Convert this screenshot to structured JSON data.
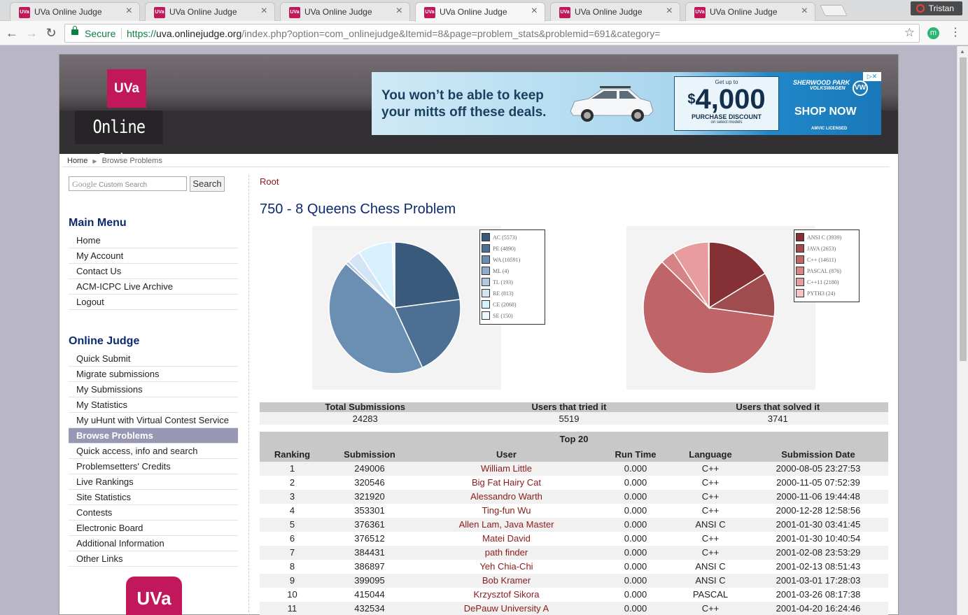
{
  "browser": {
    "tabs": [
      {
        "title": "UVa Online Judge",
        "active": false
      },
      {
        "title": "UVa Online Judge",
        "active": false
      },
      {
        "title": "UVa Online Judge",
        "active": false
      },
      {
        "title": "UVa Online Judge",
        "active": true
      },
      {
        "title": "UVa Online Judge",
        "active": false
      },
      {
        "title": "UVa Online Judge",
        "active": false
      }
    ],
    "favicon_text": "UVa",
    "profile_name": "Tristan",
    "secure_label": "Secure",
    "url_scheme": "https://",
    "url_host": "uva.onlinejudge.org",
    "url_path": "/index.php?option=com_onlinejudge&Itemid=8&page=problem_stats&problemid=691&category=",
    "extension_letter": "m"
  },
  "header": {
    "logo_short": "UVa",
    "logo_text": "Online Judge"
  },
  "ad": {
    "headline_1": "You won’t be able to keep",
    "headline_2": "your mitts off these deals.",
    "get_up_to": "Get up to",
    "currency": "$",
    "amount": "4,000",
    "discount_label": "PURCHASE DISCOUNT",
    "discount_note": "on select models",
    "dealer": "SHERWOOD PARK",
    "dealer_sub": "VOLKSWAGEN",
    "logo_letters": "VW",
    "cta": "SHOP NOW",
    "license": "AMVIC LICENSED"
  },
  "breadcrumb": {
    "home": "Home",
    "current": "Browse Problems"
  },
  "search": {
    "google_label": "Google",
    "placeholder": "Custom Search",
    "button": "Search"
  },
  "main_menu": {
    "heading": "Main Menu",
    "items": [
      "Home",
      "My Account",
      "Contact Us",
      "ACM-ICPC Live Archive",
      "Logout"
    ]
  },
  "oj_menu": {
    "heading": "Online Judge",
    "items": [
      "Quick Submit",
      "Migrate submissions",
      "My Submissions",
      "My Statistics",
      "My uHunt with Virtual Contest Service",
      "Browse Problems",
      "Quick access, info and search",
      "Problemsetters' Credits",
      "Live Rankings",
      "Site Statistics",
      "Contests",
      "Electronic Board",
      "Additional Information",
      "Other Links"
    ],
    "active_index": 5
  },
  "bottom_logo": "UVa",
  "content": {
    "root_link": "Root",
    "problem_title": "750 - 8 Queens Chess Problem"
  },
  "verdict_chart": {
    "labels": [
      "AC (5573)",
      "PE (4890)",
      "WA (10591)",
      "ML (4)",
      "TL (193)",
      "RE (813)",
      "CE (2068)",
      "SE (150)"
    ],
    "values": [
      5573,
      4890,
      10591,
      4,
      193,
      813,
      2068,
      150
    ],
    "colors": [
      "#3a5a7c",
      "#4d6f93",
      "#6b8fb3",
      "#90acc9",
      "#b1c8df",
      "#d3e5f5",
      "#d6f1fd",
      "#eaf8fe"
    ]
  },
  "language_chart": {
    "labels": [
      "ANSI C (3939)",
      "JAVA (2653)",
      "C++ (14611)",
      "PASCAL (876)",
      "C++11 (2180)",
      "PYTH3 (24)"
    ],
    "values": [
      3939,
      2653,
      14611,
      876,
      2180,
      24
    ],
    "colors": [
      "#843034",
      "#a04b4e",
      "#bf6567",
      "#d68385",
      "#e99c9d",
      "#f5c3c3"
    ]
  },
  "stats": {
    "headers": [
      "Total Submissions",
      "Users that tried it",
      "Users that solved it"
    ],
    "values": [
      "24283",
      "5519",
      "3741"
    ]
  },
  "top20": {
    "caption": "Top 20",
    "headers": [
      "Ranking",
      "Submission",
      "User",
      "Run Time",
      "Language",
      "Submission Date"
    ],
    "rows": [
      [
        "1",
        "249006",
        "William Little",
        "0.000",
        "C++",
        "2000-08-05 23:27:53"
      ],
      [
        "2",
        "320546",
        "Big Fat Hairy Cat",
        "0.000",
        "C++",
        "2000-11-05 07:52:39"
      ],
      [
        "3",
        "321920",
        "Alessandro Warth",
        "0.000",
        "C++",
        "2000-11-06 19:44:48"
      ],
      [
        "4",
        "353301",
        "Ting-fun Wu",
        "0.000",
        "C++",
        "2000-12-28 12:58:56"
      ],
      [
        "5",
        "376361",
        "Allen Lam, Java Master",
        "0.000",
        "ANSI C",
        "2001-01-30 03:41:45"
      ],
      [
        "6",
        "376512",
        "Matei David",
        "0.000",
        "C++",
        "2001-01-30 10:40:54"
      ],
      [
        "7",
        "384431",
        "path finder",
        "0.000",
        "C++",
        "2001-02-08 23:53:29"
      ],
      [
        "8",
        "386897",
        "Yeh Chia-Chi",
        "0.000",
        "ANSI C",
        "2001-02-13 08:51:43"
      ],
      [
        "9",
        "399095",
        "Bob Kramer",
        "0.000",
        "ANSI C",
        "2001-03-01 17:28:03"
      ],
      [
        "10",
        "415044",
        "Krzysztof Sikora",
        "0.000",
        "PASCAL",
        "2001-03-26 08:17:38"
      ],
      [
        "11",
        "432534",
        "DePauw University A",
        "0.000",
        "C++",
        "2001-04-20 16:24:46"
      ]
    ]
  }
}
